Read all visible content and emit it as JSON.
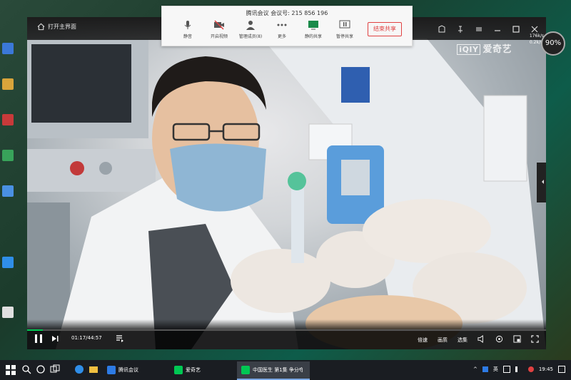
{
  "meeting": {
    "title": "腾讯会议 会议号: 215 856 196",
    "items": [
      {
        "label": "静音",
        "icon": "mic-icon",
        "caret": true
      },
      {
        "label": "开启视频",
        "icon": "camera-off-icon",
        "caret": true
      },
      {
        "label": "管理成员(8)",
        "icon": "members-icon",
        "caret": false
      },
      {
        "label": "更多",
        "icon": "more-icon",
        "caret": false
      },
      {
        "label": "静的共享",
        "icon": "share-icon",
        "caret": false
      },
      {
        "label": "暂停共享",
        "icon": "pause-share-icon",
        "caret": false
      }
    ],
    "end_label": "结束共享"
  },
  "player": {
    "home_label": "打开主界面",
    "logo_text": "爱奇艺",
    "logo_box": "iQIY",
    "cpu_percent": "90%",
    "net_up": "176k/s",
    "net_down": "0.2k/s",
    "time": "01:17/44:57",
    "progress": 0.03,
    "right_controls": [
      "倍速",
      "画质",
      "选集"
    ]
  },
  "taskbar": {
    "tasks": [
      {
        "label": "腾讯会议",
        "color": "#2d7be5"
      },
      {
        "label": "爱奇艺",
        "color": "#00c853"
      },
      {
        "label": "中国医生 第1集 争分夺...",
        "color": "#00c853",
        "active": true
      }
    ],
    "ime": "英",
    "clock": "19:45"
  },
  "colors": {
    "accent_green": "#00c853",
    "end_red": "#e04141"
  }
}
